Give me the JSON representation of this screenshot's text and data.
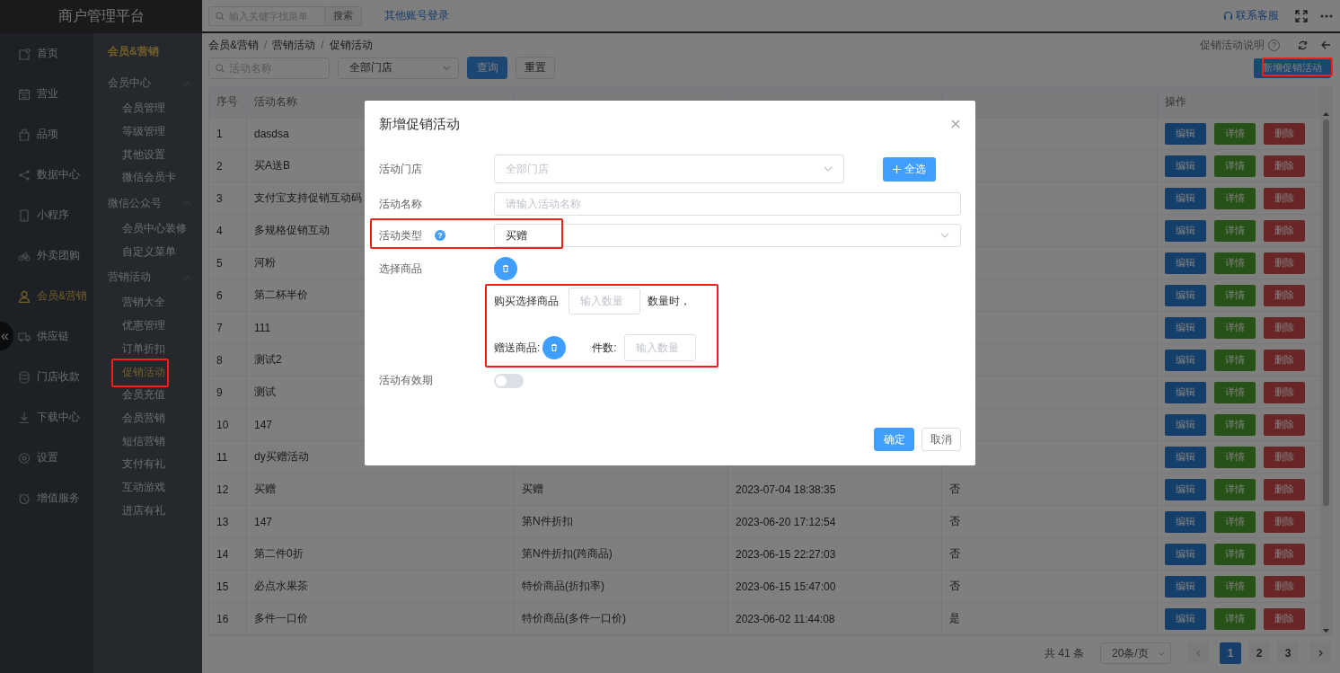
{
  "brand": {
    "title": "商户管理平台"
  },
  "top_bar": {
    "search_placeholder": "输入关键字找菜单",
    "search_button": "搜索",
    "link": "其他账号登录",
    "support": "联系客服"
  },
  "nav": [
    {
      "label": "首页",
      "selected": false
    },
    {
      "label": "营业",
      "selected": false
    },
    {
      "label": "品项",
      "selected": false
    },
    {
      "label": "数据中心",
      "selected": false
    },
    {
      "label": "小程序",
      "selected": false
    },
    {
      "label": "外卖团购",
      "selected": false
    },
    {
      "label": "会员&营销",
      "selected": true
    },
    {
      "label": "供应链",
      "selected": false
    },
    {
      "label": "门店收款",
      "selected": false
    },
    {
      "label": "下载中心",
      "selected": false
    },
    {
      "label": "设置",
      "selected": false
    },
    {
      "label": "增值服务",
      "selected": false
    }
  ],
  "collapse_glyph": "«",
  "sub_nav": {
    "title": "会员&营销",
    "groups": [
      {
        "label": "会员中心",
        "expanded": true,
        "items": [
          {
            "label": "会员管理",
            "selected": false,
            "highlighted": false
          },
          {
            "label": "等级管理",
            "selected": false,
            "highlighted": false
          },
          {
            "label": "其他设置",
            "selected": false,
            "highlighted": false
          },
          {
            "label": "微信会员卡",
            "selected": false,
            "highlighted": false
          }
        ]
      },
      {
        "label": "微信公众号",
        "expanded": true,
        "items": [
          {
            "label": "会员中心装修",
            "selected": false,
            "highlighted": false
          },
          {
            "label": "自定义菜单",
            "selected": false,
            "highlighted": false
          }
        ]
      },
      {
        "label": "营销活动",
        "expanded": true,
        "items": [
          {
            "label": "营销大全",
            "selected": false,
            "highlighted": false
          },
          {
            "label": "优惠管理",
            "selected": false,
            "highlighted": false
          },
          {
            "label": "订单折扣",
            "selected": false,
            "highlighted": false
          },
          {
            "label": "促销活动",
            "selected": true,
            "highlighted": true
          },
          {
            "label": "会员充值",
            "selected": false,
            "highlighted": false
          },
          {
            "label": "会员营销",
            "selected": false,
            "highlighted": false
          },
          {
            "label": "短信营销",
            "selected": false,
            "highlighted": false
          },
          {
            "label": "支付有礼",
            "selected": false,
            "highlighted": false
          },
          {
            "label": "互动游戏",
            "selected": false,
            "highlighted": false
          },
          {
            "label": "进店有礼",
            "selected": false,
            "highlighted": false
          }
        ]
      }
    ]
  },
  "breadcrumb": [
    {
      "kind": "crumb",
      "label": "会员&营销"
    },
    {
      "kind": "separator",
      "label": "/"
    },
    {
      "kind": "crumb",
      "label": "营销活动"
    },
    {
      "kind": "separator",
      "label": "/"
    },
    {
      "kind": "current",
      "label": "促销活动"
    }
  ],
  "help": {
    "label": "促销活动说明",
    "glyph": "?"
  },
  "filters": {
    "name_placeholder": "活动名称",
    "store_value": "全部门店",
    "query_button": "查询",
    "reset_button": "重置"
  },
  "add_button": {
    "label": "新增促销活动",
    "highlighted": true
  },
  "table": {
    "columns": {
      "index": "序号",
      "name": "活动名称",
      "actions": "操作"
    },
    "rows": [
      {
        "index": "1",
        "name": "dasdsa",
        "actions": [
          {
            "kind": "edit",
            "label": "编辑"
          },
          {
            "kind": "detail",
            "label": "详情"
          },
          {
            "kind": "delete",
            "label": "删除"
          }
        ]
      },
      {
        "index": "2",
        "name": "买A送B",
        "actions": [
          {
            "kind": "edit",
            "label": "编辑"
          },
          {
            "kind": "detail",
            "label": "详情"
          },
          {
            "kind": "delete",
            "label": "删除"
          }
        ]
      },
      {
        "index": "3",
        "name": "支付宝支持促销互动码",
        "actions": [
          {
            "kind": "edit",
            "label": "编辑"
          },
          {
            "kind": "detail",
            "label": "详情"
          },
          {
            "kind": "delete",
            "label": "删除"
          }
        ]
      },
      {
        "index": "4",
        "name": "多规格促销互动",
        "actions": [
          {
            "kind": "edit",
            "label": "编辑"
          },
          {
            "kind": "detail",
            "label": "详情"
          },
          {
            "kind": "delete",
            "label": "删除"
          }
        ]
      },
      {
        "index": "5",
        "name": "河粉",
        "actions": [
          {
            "kind": "edit",
            "label": "编辑"
          },
          {
            "kind": "detail",
            "label": "详情"
          },
          {
            "kind": "delete",
            "label": "删除"
          }
        ]
      },
      {
        "index": "6",
        "name": "第二杯半价",
        "actions": [
          {
            "kind": "edit",
            "label": "编辑"
          },
          {
            "kind": "detail",
            "label": "详情"
          },
          {
            "kind": "delete",
            "label": "删除"
          }
        ]
      },
      {
        "index": "7",
        "name": "111",
        "actions": [
          {
            "kind": "edit",
            "label": "编辑"
          },
          {
            "kind": "detail",
            "label": "详情"
          },
          {
            "kind": "delete",
            "label": "删除"
          }
        ]
      },
      {
        "index": "8",
        "name": "测试2",
        "actions": [
          {
            "kind": "edit",
            "label": "编辑"
          },
          {
            "kind": "detail",
            "label": "详情"
          },
          {
            "kind": "delete",
            "label": "删除"
          }
        ]
      },
      {
        "index": "9",
        "name": "测试",
        "actions": [
          {
            "kind": "edit",
            "label": "编辑"
          },
          {
            "kind": "detail",
            "label": "详情"
          },
          {
            "kind": "delete",
            "label": "删除"
          }
        ]
      },
      {
        "index": "10",
        "name": "147",
        "actions": [
          {
            "kind": "edit",
            "label": "编辑"
          },
          {
            "kind": "detail",
            "label": "详情"
          },
          {
            "kind": "delete",
            "label": "删除"
          }
        ]
      },
      {
        "index": "11",
        "name": "dy买赠活动",
        "actions": [
          {
            "kind": "edit",
            "label": "编辑"
          },
          {
            "kind": "detail",
            "label": "详情"
          },
          {
            "kind": "delete",
            "label": "删除"
          }
        ]
      },
      {
        "index": "12",
        "name": "买赠",
        "type": "买赠",
        "created": "2023-07-04 18:38:35",
        "valid": "否",
        "actions": [
          {
            "kind": "edit",
            "label": "编辑"
          },
          {
            "kind": "detail",
            "label": "详情"
          },
          {
            "kind": "delete",
            "label": "删除"
          }
        ]
      },
      {
        "index": "13",
        "name": "147",
        "type": "第N件折扣",
        "created": "2023-06-20 17:12:54",
        "valid": "否",
        "actions": [
          {
            "kind": "edit",
            "label": "编辑"
          },
          {
            "kind": "detail",
            "label": "详情"
          },
          {
            "kind": "delete",
            "label": "删除"
          }
        ]
      },
      {
        "index": "14",
        "name": "第二件0折",
        "type": "第N件折扣(跨商品)",
        "created": "2023-06-15 22:27:03",
        "valid": "否",
        "actions": [
          {
            "kind": "edit",
            "label": "编辑"
          },
          {
            "kind": "detail",
            "label": "详情"
          },
          {
            "kind": "delete",
            "label": "删除"
          }
        ]
      },
      {
        "index": "15",
        "name": "必点水果茶",
        "type": "特价商品(折扣率)",
        "created": "2023-06-15 15:47:00",
        "valid": "否",
        "actions": [
          {
            "kind": "edit",
            "label": "编辑"
          },
          {
            "kind": "detail",
            "label": "详情"
          },
          {
            "kind": "delete",
            "label": "删除"
          }
        ]
      },
      {
        "index": "16",
        "name": "多件一口价",
        "type": "特价商品(多件一口价)",
        "created": "2023-06-02 11:44:08",
        "valid": "是",
        "actions": [
          {
            "kind": "edit",
            "label": "编辑"
          },
          {
            "kind": "detail",
            "label": "详情"
          },
          {
            "kind": "delete",
            "label": "删除"
          }
        ]
      }
    ]
  },
  "pagination": {
    "total": "共 41 条",
    "page_size": "20条/页",
    "pages": [
      {
        "label": "1",
        "selected": true
      },
      {
        "label": "2",
        "selected": false
      },
      {
        "label": "3",
        "selected": false
      }
    ]
  },
  "modal": {
    "title": "新增促销活动",
    "fields": [
      {
        "kind": "store",
        "label": "活动门店",
        "placeholder": "全部门店",
        "button": "全选",
        "highlighted": false
      },
      {
        "kind": "input",
        "label": "活动名称",
        "placeholder": "请输入活动名称",
        "highlighted": false
      },
      {
        "kind": "select",
        "label": "活动类型",
        "value": "买赠",
        "help_glyph": "?",
        "highlighted": true
      },
      {
        "kind": "goods",
        "label": "选择商品",
        "highlighted": false
      },
      {
        "kind": "rule",
        "buy_label": "购买选择商品",
        "qty_placeholder": "输入数量",
        "qty_suffix": "数量时，",
        "gift_label": "赠送商品:",
        "count_label": "件数:",
        "count_placeholder": "输入数量",
        "highlighted": true
      },
      {
        "kind": "toggle",
        "label": "活动有效期",
        "on": false,
        "highlighted": false
      }
    ],
    "confirm": "确定",
    "cancel": "取消"
  }
}
